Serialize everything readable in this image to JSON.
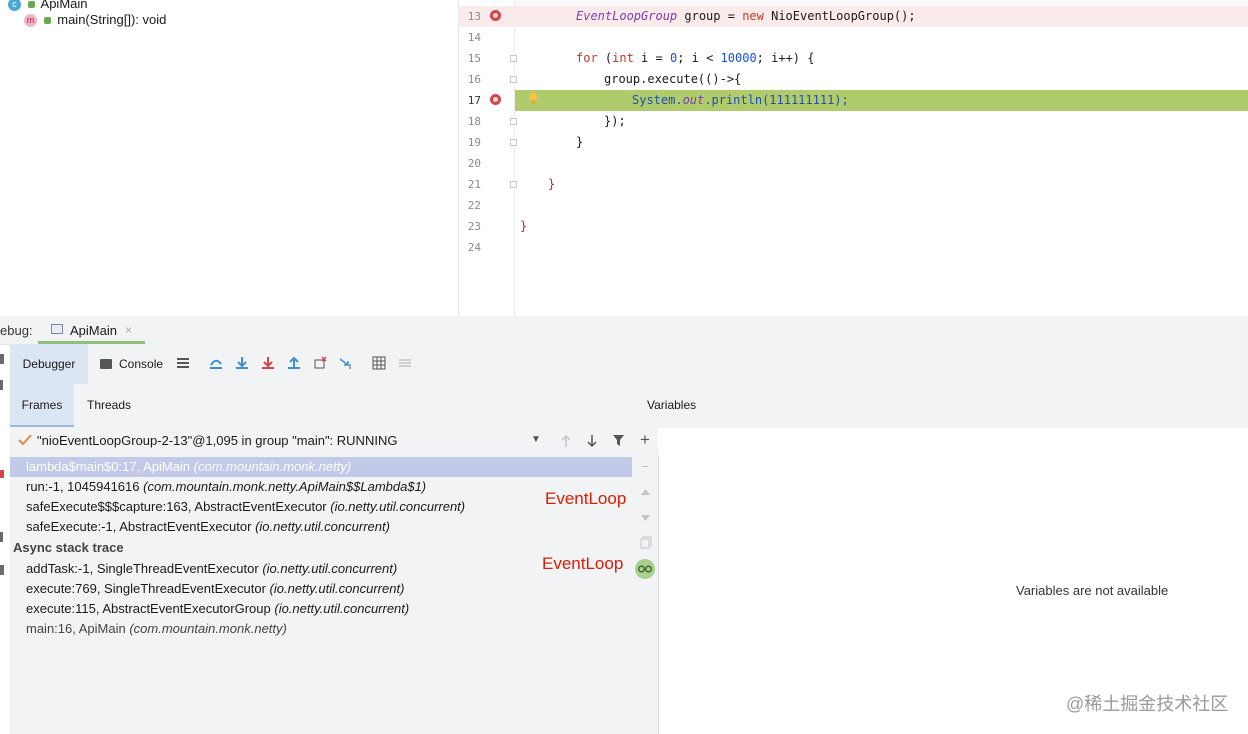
{
  "project_tree": {
    "class_name": "ApiMain",
    "method": "main(String[]): void"
  },
  "editor": {
    "lines": [
      {
        "n": "13"
      },
      {
        "n": "14"
      },
      {
        "n": "15"
      },
      {
        "n": "16"
      },
      {
        "n": "17"
      },
      {
        "n": "18"
      },
      {
        "n": "19"
      },
      {
        "n": "20"
      },
      {
        "n": "21"
      },
      {
        "n": "22"
      },
      {
        "n": "23"
      },
      {
        "n": "24"
      }
    ],
    "code": {
      "l13_type": "EventLoopGroup",
      "l13_rest": " group = ",
      "l13_new": "new ",
      "l13_ctor": "NioEventLoopGroup",
      "l13_end": "();",
      "l15_for": "for ",
      "l15_paren": "(",
      "l15_int": "int ",
      "l15_mid1": "i = ",
      "l15_zero": "0",
      "l15_mid2": "; i < ",
      "l15_lim": "10000",
      "l15_end": "; i++) {",
      "l16": "group.execute(()->{",
      "l17_sys": "System.",
      "l17_out": "out",
      "l17_rest": ".println(111111111);",
      "l18": "});",
      "l19": "}",
      "l21": "}",
      "l23": "}"
    }
  },
  "debug_bar": {
    "label": "ebug:",
    "tab": "ApiMain",
    "close": "×"
  },
  "toolbar": {
    "debugger": "Debugger",
    "console": "Console"
  },
  "subtabs": {
    "frames": "Frames",
    "threads": "Threads",
    "variables": "Variables"
  },
  "thread": {
    "label": "\"nioEventLoopGroup-2-13\"@1,095 in group \"main\": RUNNING"
  },
  "frames": [
    {
      "method": "lambda$main$0:17, ApiMain ",
      "pkg": "(com.mountain.monk.netty)"
    },
    {
      "method": "run:-1, 1045941616 ",
      "pkg": "(com.mountain.monk.netty.ApiMain$$Lambda$1)"
    },
    {
      "method": "safeExecute$$$capture:163, AbstractEventExecutor ",
      "pkg": "(io.netty.util.concurrent)"
    },
    {
      "method": "safeExecute:-1, AbstractEventExecutor ",
      "pkg": "(io.netty.util.concurrent)"
    }
  ],
  "async_header": "Async stack trace",
  "async_frames": [
    {
      "method": "addTask:-1, SingleThreadEventExecutor ",
      "pkg": "(io.netty.util.concurrent)"
    },
    {
      "method": "execute:769, SingleThreadEventExecutor ",
      "pkg": "(io.netty.util.concurrent)"
    },
    {
      "method": "execute:115, AbstractEventExecutorGroup ",
      "pkg": "(io.netty.util.concurrent)"
    },
    {
      "method": "main:16, ApiMain ",
      "pkg": "(com.mountain.monk.netty)"
    }
  ],
  "annotations": {
    "a1": "EventLoop",
    "a2": "EventLoop"
  },
  "variables_empty": "Variables are not available",
  "watermark": "@稀土掘金技术社区",
  "colors": {
    "current_line": "#b0cb6b",
    "breakpoint_line": "#fbeaea",
    "selected_frame": "#c3c9e9",
    "annotation_red": "#d81e06"
  }
}
